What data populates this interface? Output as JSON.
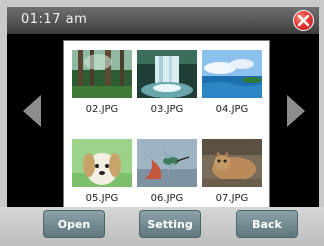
{
  "status": {
    "time": "01:17 am"
  },
  "icons": {
    "close": "close-icon",
    "prev": "arrow-left-icon",
    "next": "arrow-right-icon"
  },
  "gallery": {
    "items": [
      {
        "label": "02.JPG"
      },
      {
        "label": "03.JPG"
      },
      {
        "label": "04.JPG"
      },
      {
        "label": "05.JPG"
      },
      {
        "label": "06.JPG"
      },
      {
        "label": "07.JPG"
      }
    ]
  },
  "buttons": {
    "open": "Open",
    "setting": "Setting",
    "back": "Back"
  },
  "colors": {
    "close_red": "#e53935",
    "button_teal": "#6f878d"
  }
}
